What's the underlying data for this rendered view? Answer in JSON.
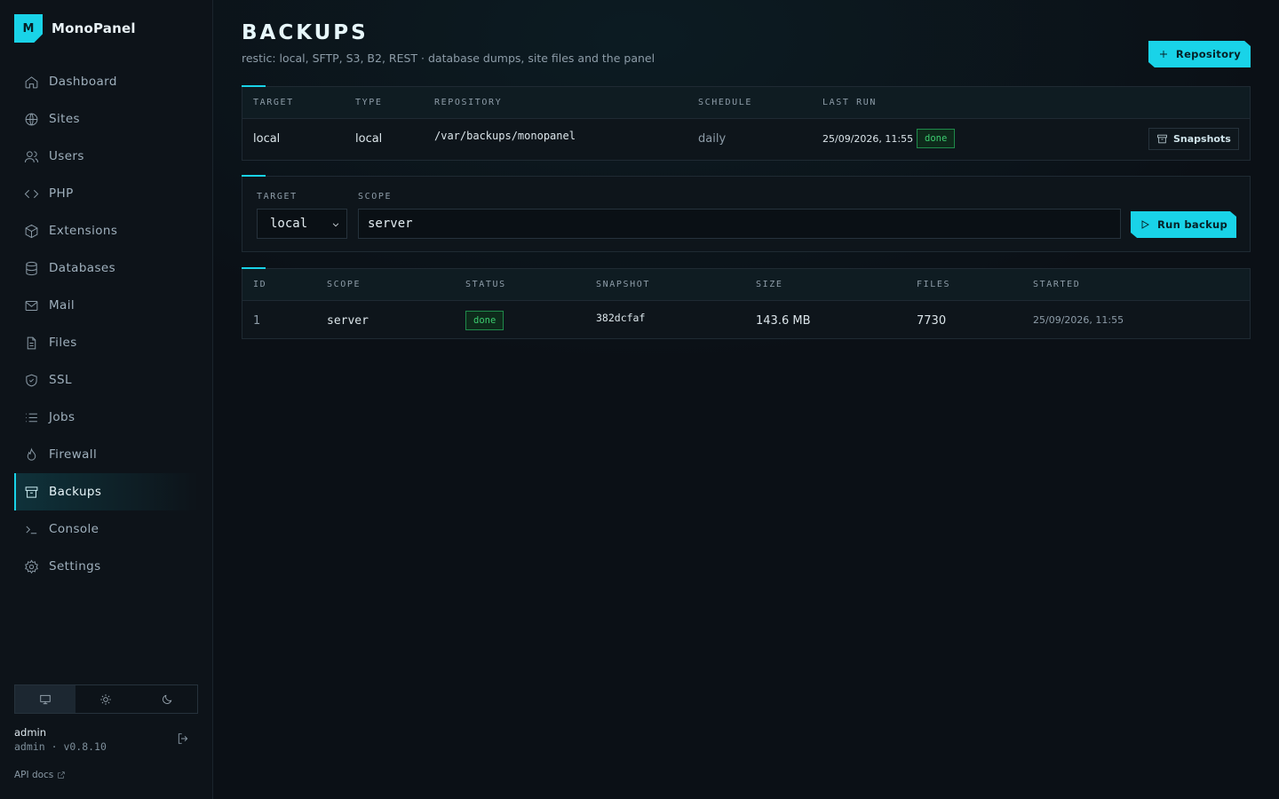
{
  "brand": {
    "logo_letter": "M",
    "name": "MonoPanel",
    "accent": "#19d3e8"
  },
  "sidebar": {
    "items": [
      {
        "label": "Dashboard",
        "icon": "home-icon"
      },
      {
        "label": "Sites",
        "icon": "globe-icon"
      },
      {
        "label": "Users",
        "icon": "users-icon"
      },
      {
        "label": "PHP",
        "icon": "code-icon"
      },
      {
        "label": "Extensions",
        "icon": "package-icon"
      },
      {
        "label": "Databases",
        "icon": "database-icon"
      },
      {
        "label": "Mail",
        "icon": "mail-icon"
      },
      {
        "label": "Files",
        "icon": "file-icon"
      },
      {
        "label": "SSL",
        "icon": "shield-icon"
      },
      {
        "label": "Jobs",
        "icon": "list-icon"
      },
      {
        "label": "Firewall",
        "icon": "flame-icon"
      },
      {
        "label": "Backups",
        "icon": "archive-icon",
        "active": true
      },
      {
        "label": "Console",
        "icon": "terminal-icon"
      },
      {
        "label": "Settings",
        "icon": "gear-icon"
      }
    ],
    "theme_options": [
      "system",
      "light",
      "dark"
    ],
    "theme_selected": "system",
    "user": {
      "name": "admin",
      "role": "admin",
      "separator": "·",
      "version": "v0.8.10"
    },
    "api_docs_label": "API docs"
  },
  "page": {
    "title": "BACKUPS",
    "subtitle": "restic: local, SFTP, S3, B2, REST · database dumps, site files and the panel",
    "add_repository_label": "Repository"
  },
  "repositories": {
    "columns": [
      "TARGET",
      "TYPE",
      "REPOSITORY",
      "SCHEDULE",
      "LAST RUN"
    ],
    "rows": [
      {
        "target": "local",
        "type": "local",
        "repository": "/var/backups/monopanel",
        "schedule": "daily",
        "last_run": "25/09/2026, 11:55 ·",
        "status": "done",
        "action_label": "Snapshots"
      }
    ]
  },
  "run_form": {
    "target_label": "TARGET",
    "target_value": "local",
    "scope_label": "SCOPE",
    "scope_value": "server",
    "run_label": "Run backup"
  },
  "history": {
    "columns": [
      "ID",
      "SCOPE",
      "STATUS",
      "SNAPSHOT",
      "SIZE",
      "FILES",
      "STARTED"
    ],
    "rows": [
      {
        "id": "1",
        "scope": "server",
        "status": "done",
        "snapshot": "382dcfaf",
        "size": "143.6 MB",
        "files": "7730",
        "started": "25/09/2026, 11:55"
      }
    ]
  },
  "colors": {
    "accent": "#19d3e8",
    "success": "#3ccc6f",
    "background": "#0b1016"
  }
}
